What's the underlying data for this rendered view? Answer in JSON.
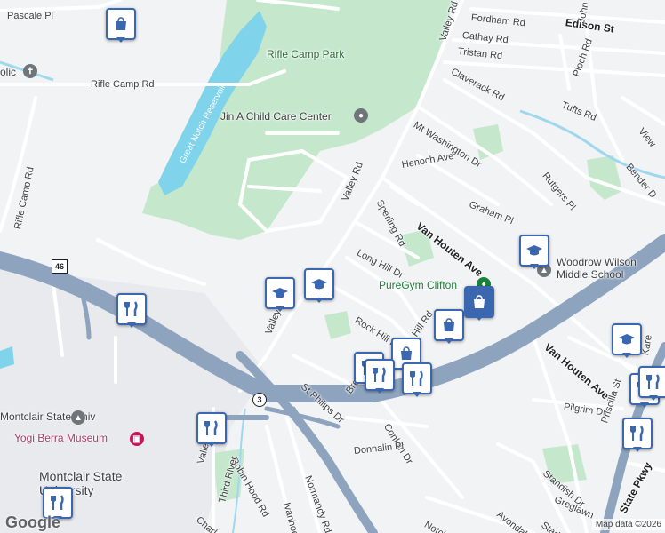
{
  "map": {
    "parks": [
      "Rifle Camp Park"
    ],
    "water": [
      "Great Notch Reservoir"
    ],
    "streets": [
      "Pascale Pl",
      "Rifle Camp Rd",
      "Rifle Camp Rd",
      "Valley Rd",
      "Fordham Rd",
      "Cathay Rd",
      "Tristan Rd",
      "Edison St",
      "John",
      "Claverack Rd",
      "Ploch Rd",
      "Tufts Rd",
      "Mt Washington Dr",
      "Henoch Ave",
      "Rutgers Pl",
      "Bender D",
      "View",
      "Sperling Rd",
      "Graham Pl",
      "Van Houten Ave",
      "Long Hill Dr",
      "Rock Hill Rd",
      "Hill Rd",
      "St Philips Dr",
      "Bre",
      "Conklin Dr",
      "Donnalin Pl",
      "Normandy Rd",
      "Ivanhoe Ln",
      "Robin Hood Rd",
      "Third River",
      "Charles",
      "Van Houten Ave",
      "Pilgrim Dr",
      "Priscilla St",
      "Standish Dr",
      "Greglawn",
      "Avondale",
      "Stadm",
      "Notch",
      "Valley",
      "Valley",
      "Kare",
      "State Pkwy"
    ],
    "pois": {
      "childcare": "Jin A Child Care Center",
      "gym": "PureGym Clifton",
      "school": "Woodrow Wilson\nMiddle School",
      "museum": "Yogi Berra Museum",
      "university_a": "Montclair State Univ",
      "university_b": "Montclair State\nUniversity",
      "church": "olic"
    },
    "shields": {
      "route46": "46",
      "route3": "3"
    },
    "colors": {
      "background": "#f1f3f4",
      "park": "#c5e8cc",
      "water": "#7fd3ea",
      "highway": "#8ea4be",
      "road": "#ffffff",
      "pin": "#3a67b0"
    },
    "pin_icons": [
      "shopping-bag",
      "education",
      "education",
      "restaurant",
      "restaurant",
      "restaurant",
      "restaurant",
      "restaurant",
      "restaurant",
      "restaurant",
      "shopping-bag",
      "shopping-bag",
      "shopping-bag",
      "education",
      "education",
      "restaurant",
      "restaurant",
      "restaurant"
    ],
    "logo": "Google",
    "attribution": "Map data ©2026"
  }
}
